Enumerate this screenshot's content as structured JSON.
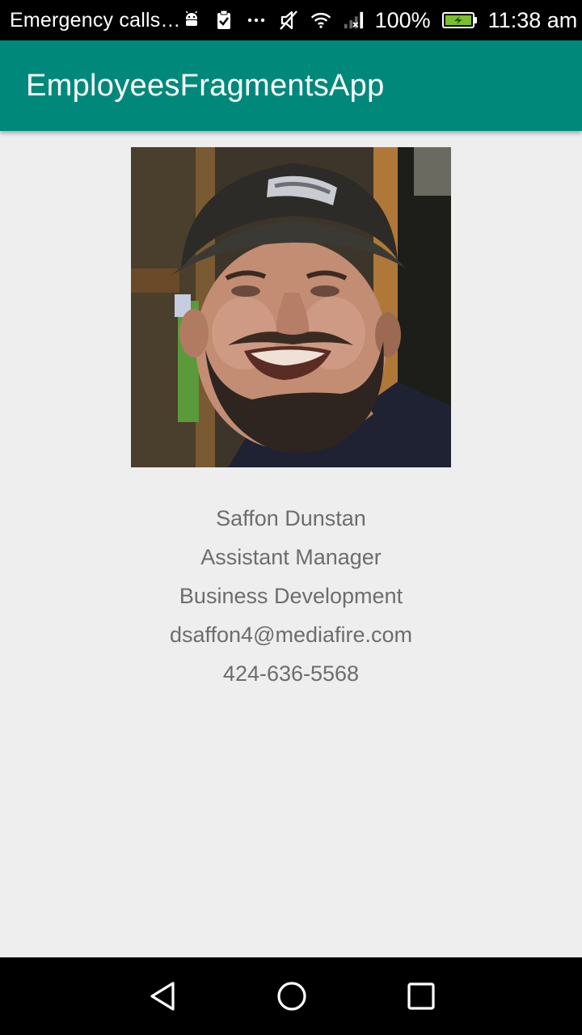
{
  "status_bar": {
    "carrier_text": "Emergency calls…",
    "battery_percent": "100%",
    "time": "11:38 am",
    "icons": [
      "android-debug-icon",
      "clipboard-check-icon",
      "more-notifications-icon",
      "silent-mode-icon",
      "wifi-icon",
      "no-signal-icon",
      "battery-charging-icon"
    ],
    "battery_color": "#7cbf2b"
  },
  "app_bar": {
    "title": "EmployeesFragmentsApp",
    "color": "#00897b"
  },
  "employee": {
    "photo_icon": "employee-photo",
    "name": "Saffon Dunstan",
    "title": "Assistant Manager",
    "department": "Business Development",
    "email": "dsaffon4@mediafire.com",
    "phone": "424-636-5568"
  },
  "nav_bar": {
    "buttons": [
      "back-icon",
      "home-icon",
      "recents-icon"
    ]
  }
}
